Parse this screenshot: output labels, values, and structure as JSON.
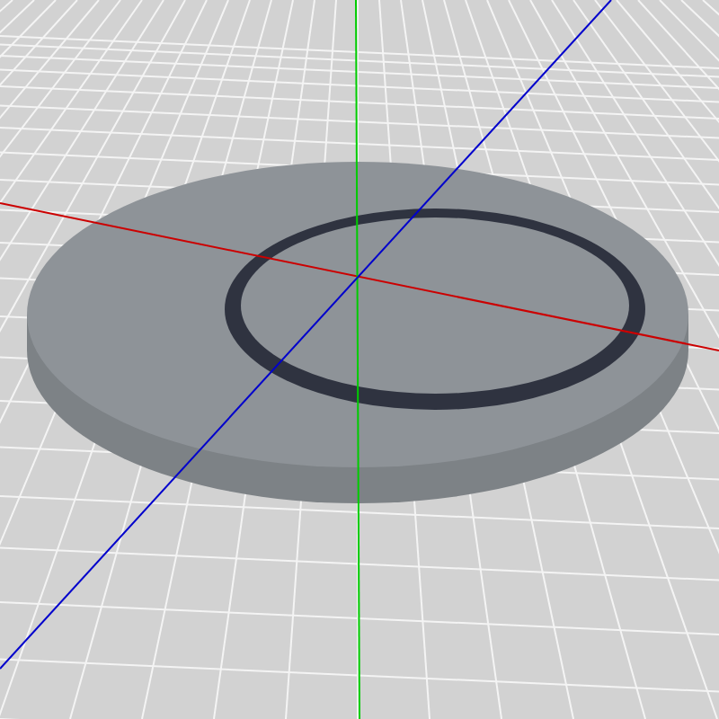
{
  "viewport": {
    "axes": [
      {
        "color": "#cc0000"
      },
      {
        "color": "#00cc00"
      },
      {
        "color": "#0000cc"
      }
    ]
  }
}
